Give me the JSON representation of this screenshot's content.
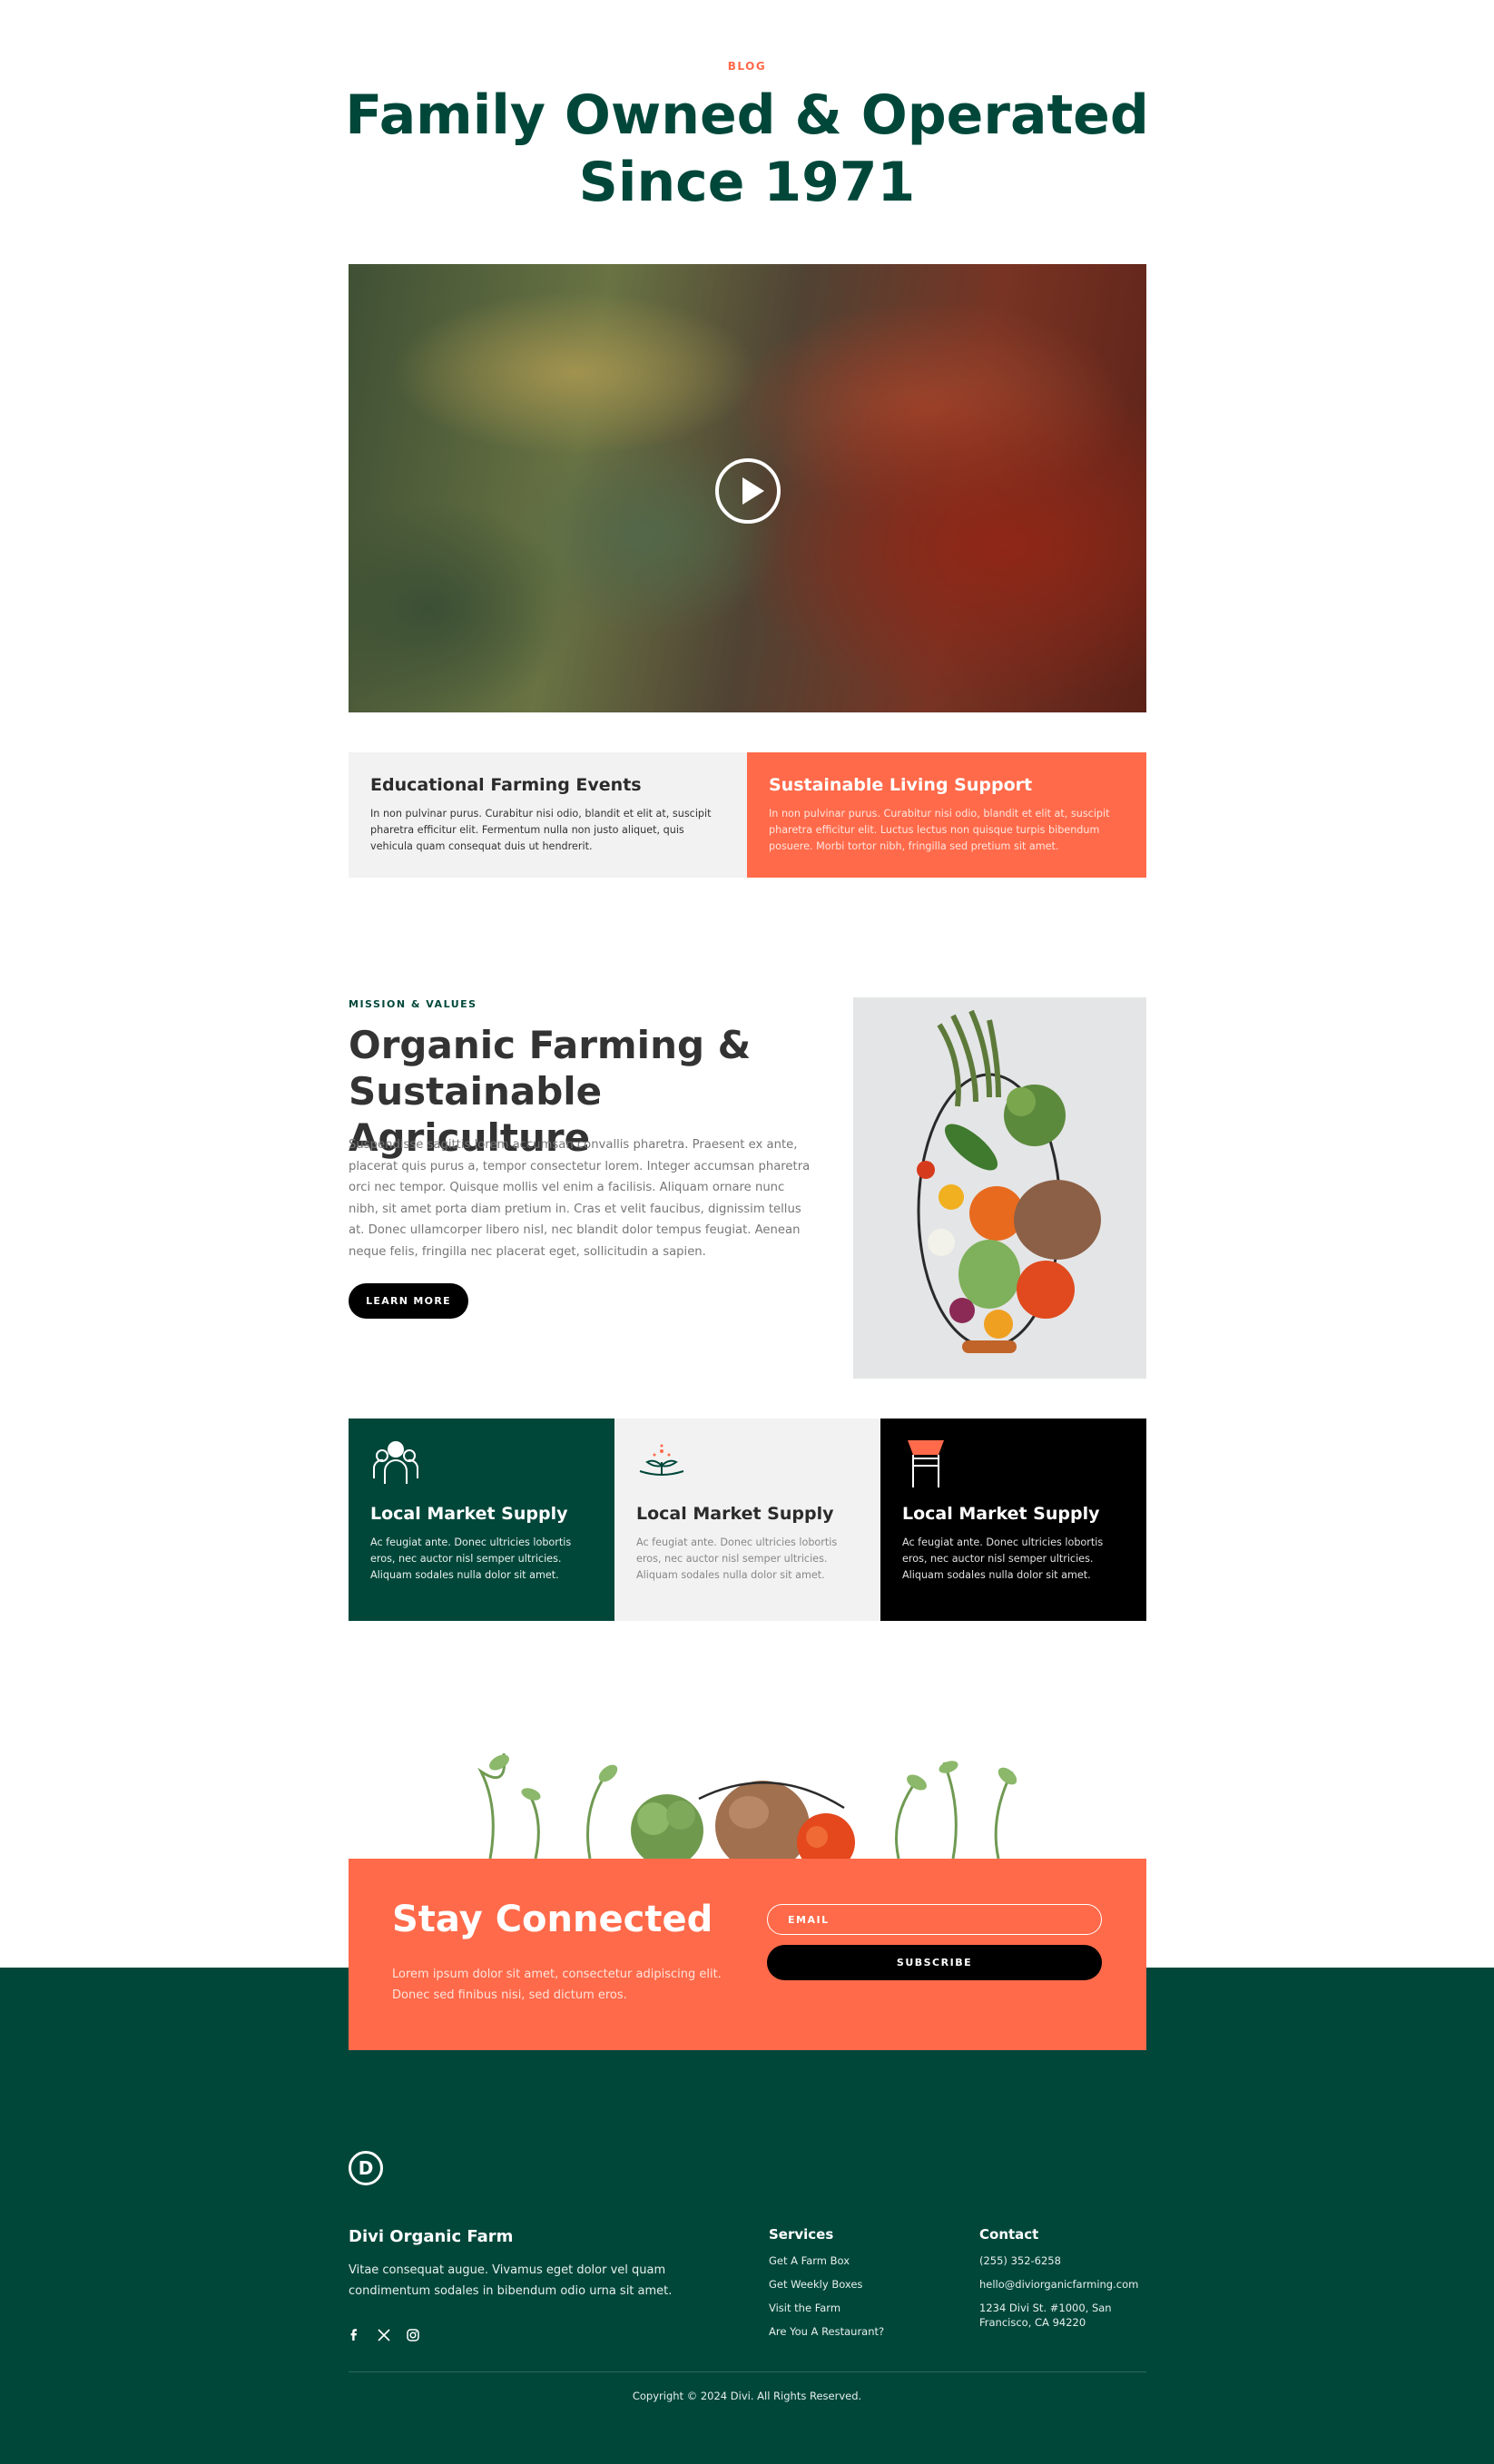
{
  "header": {
    "eyebrow": "BLOG",
    "title": "Family Owned & Operated Since 1971"
  },
  "video": {
    "play_icon": "play-circle-icon"
  },
  "feature_cards": [
    {
      "title": "Educational Farming Events",
      "body": "In non pulvinar purus. Curabitur nisi odio, blandit et elit at, suscipit pharetra efficitur elit. Fermentum nulla non justo aliquet, quis vehicula quam consequat duis ut hendrerit."
    },
    {
      "title": "Sustainable Living Support",
      "body": "In non pulvinar purus. Curabitur nisi odio, blandit et elit at, suscipit pharetra efficitur elit. Luctus lectus non quisque turpis bibendum posuere. Morbi tortor nibh, fringilla sed pretium sit amet."
    }
  ],
  "mission": {
    "eyebrow": "MISSION & VALUES",
    "title": "Organic Farming & Sustainable Agriculture",
    "body": "Suspendisse sagittis lorem accumsan convallis pharetra. Praesent ex ante, placerat quis purus a, tempor consectetur lorem. Integer accumsan pharetra orci nec tempor. Quisque mollis vel enim a facilisis. Aliquam ornare nunc nibh, sit amet porta diam pretium in. Cras et velit faucibus, dignissim tellus at. Donec ullamcorper libero nisl, nec blandit dolor tempus feugiat. Aenean neque felis, fringilla nec placerat eget, sollicitudin a sapien.",
    "button": "LEARN MORE"
  },
  "supply_cards": [
    {
      "icon": "people-icon",
      "title": "Local Market Supply",
      "body": "Ac feugiat ante. Donec ultricies lobortis eros, nec auctor nisl semper ultricies. Aliquam sodales nulla dolor sit amet."
    },
    {
      "icon": "sprout-icon",
      "title": "Local Market Supply",
      "body": "Ac feugiat ante. Donec ultricies lobortis eros, nec auctor nisl semper ultricies. Aliquam sodales nulla dolor sit amet."
    },
    {
      "icon": "market-stand-icon",
      "title": "Local Market Supply",
      "body": "Ac feugiat ante. Donec ultricies lobortis eros, nec auctor nisl semper ultricies. Aliquam sodales nulla dolor sit amet."
    }
  ],
  "newsletter": {
    "title": "Stay Connected",
    "text": "Lorem ipsum dolor sit amet, consectetur adipiscing elit. Donec sed finibus nisi, sed dictum eros.",
    "email_placeholder": "EMAIL",
    "button": "SUBSCRIBE"
  },
  "footer": {
    "logo": "D",
    "name": "Divi Organic Farm",
    "description": "Vitae consequat augue. Vivamus eget dolor vel quam condimentum sodales in bibendum odio urna sit amet.",
    "social": [
      "facebook-icon",
      "x-icon",
      "instagram-icon"
    ],
    "services_title": "Services",
    "services": [
      "Get A Farm Box",
      "Get Weekly Boxes",
      "Visit the Farm",
      "Are You A Restaurant?"
    ],
    "contact_title": "Contact",
    "contact": [
      "(255) 352-6258",
      "hello@diviorganicfarming.com",
      "1234 Divi St. #1000, San Francisco, CA 94220"
    ],
    "copyright": "Copyright © 2024 Divi. All Rights Reserved."
  },
  "colors": {
    "brand_green": "#00473a",
    "accent_orange": "#ff6a4a",
    "light_grey": "#f2f2f2",
    "black": "#000000"
  }
}
